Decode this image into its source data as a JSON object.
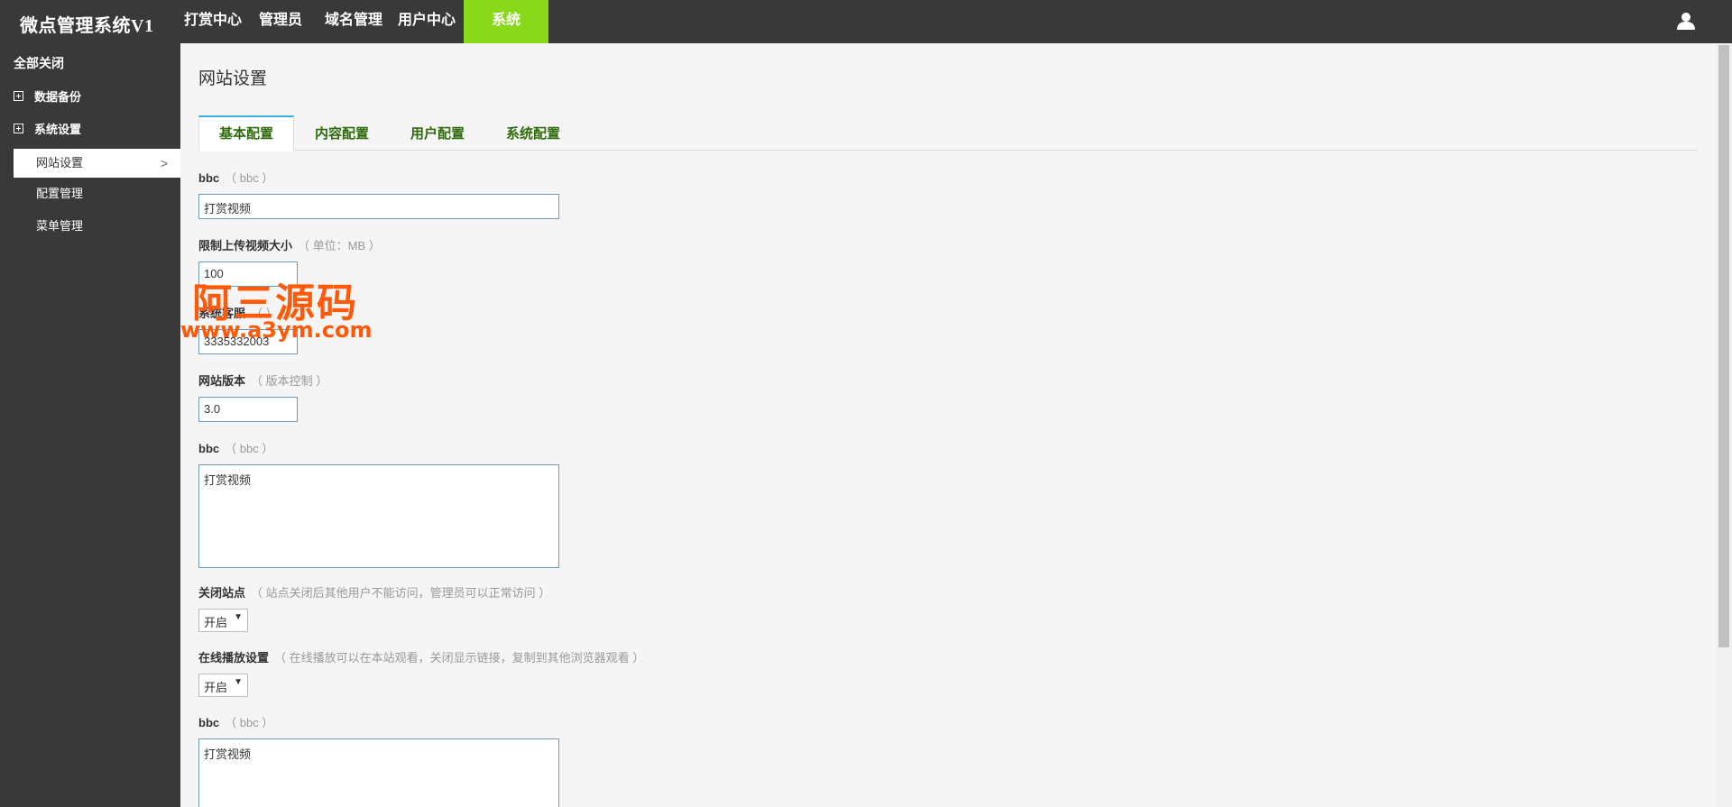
{
  "app": {
    "title": "微点管理系统V1"
  },
  "topnav": {
    "items": [
      {
        "label": "打赏中心"
      },
      {
        "label": "管理员"
      },
      {
        "label": "域名管理"
      },
      {
        "label": "用户中心"
      },
      {
        "label": "系统",
        "active": true
      }
    ]
  },
  "sidebar": {
    "collapse_all": "全部关闭",
    "groups": [
      {
        "label": "数据备份"
      },
      {
        "label": "系统设置"
      }
    ],
    "items": [
      {
        "label": "网站设置",
        "active": true
      },
      {
        "label": "配置管理"
      },
      {
        "label": "菜单管理"
      }
    ]
  },
  "main": {
    "title": "网站设置",
    "tabs": [
      {
        "label": "基本配置",
        "active": true
      },
      {
        "label": "内容配置"
      },
      {
        "label": "用户配置"
      },
      {
        "label": "系统配置"
      }
    ],
    "fields": [
      {
        "label": "bbc",
        "hint": "（ bbc ）",
        "value": "打赏视频"
      },
      {
        "label": "限制上传视频大小",
        "hint": "（ 单位：MB ）",
        "value": "100"
      },
      {
        "label": "系统客服",
        "hint": "（ ）",
        "value": "3335332003"
      },
      {
        "label": "网站版本",
        "hint": "（ 版本控制 ）",
        "value": "3.0"
      },
      {
        "label": "bbc",
        "hint": "（ bbc ）",
        "value": "打赏视频"
      },
      {
        "label": "关闭站点",
        "hint": "（ 站点关闭后其他用户不能访问，管理员可以正常访问 ）",
        "value": "开启"
      },
      {
        "label": "在线播放设置",
        "hint": "（ 在线播放可以在本站观看，关闭显示链接，复制到其他浏览器观看 ）",
        "value": "开启"
      },
      {
        "label": "bbc",
        "hint": "（ bbc ）",
        "value": "打赏视频"
      }
    ]
  },
  "watermark": {
    "line1": "阿三源码",
    "line2": "www.a3ym.com"
  },
  "colors": {
    "topbar": "#393939",
    "active_nav": "#8ad81a",
    "tab_text": "#2e6b0c",
    "tab_accent": "#3aaee9",
    "watermark": "#ff5a0a"
  },
  "icons": {
    "user": "user-icon",
    "plus": "plus-box-icon",
    "chevron": "chevron-right-icon",
    "select_arrow": "caret-down-icon"
  }
}
